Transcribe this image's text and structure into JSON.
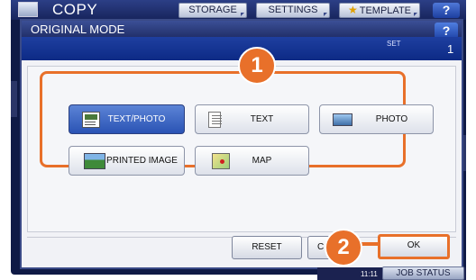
{
  "topbar": {
    "title": "COPY",
    "storage_label": "STORAGE",
    "settings_label": "SETTINGS",
    "template_label": "TEMPLATE",
    "help_label": "?"
  },
  "dialog": {
    "title": "ORIGINAL MODE",
    "help_label": "?",
    "set_label": "SET",
    "set_value": "1"
  },
  "modes": [
    {
      "label": "TEXT/PHOTO",
      "icon": "text-photo-icon",
      "selected": true
    },
    {
      "label": "TEXT",
      "icon": "text-document-icon",
      "selected": false
    },
    {
      "label": "PHOTO",
      "icon": "photo-icon",
      "selected": false
    },
    {
      "label": "PRINTED IMAGE",
      "icon": "printed-image-icon",
      "selected": false
    },
    {
      "label": "MAP",
      "icon": "map-icon",
      "selected": false
    }
  ],
  "footer": {
    "reset_label": "RESET",
    "cancel_label": "C",
    "ok_label": "OK"
  },
  "callouts": {
    "step1": "1",
    "step2": "2"
  },
  "status": {
    "time": "11:11",
    "job_status_label": "JOB STATUS"
  },
  "colors": {
    "accent": "#e8702a",
    "header": "#0d2a85",
    "selected": "#2a53b4"
  }
}
